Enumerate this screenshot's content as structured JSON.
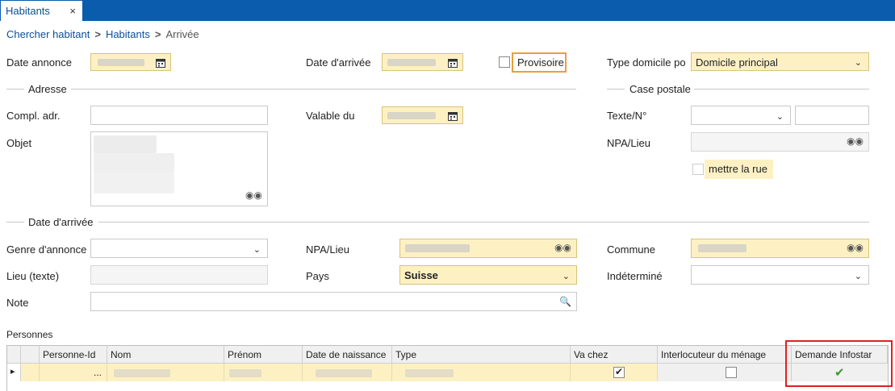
{
  "tab": {
    "label": "Habitants",
    "close": "×"
  },
  "breadcrumb": {
    "item1": "Chercher habitant",
    "item2": "Habitants",
    "current": "Arrivée",
    "sep": ">"
  },
  "top": {
    "date_annonce_label": "Date annonce",
    "date_arrivee_label": "Date d'arrivée",
    "provisoire_label": "Provisoire",
    "type_domicile_label": "Type domicile po",
    "type_domicile_value": "Domicile principal"
  },
  "adresse": {
    "section": "Adresse",
    "compl_label": "Compl. adr.",
    "valable_label": "Valable du",
    "objet_label": "Objet"
  },
  "case_postale": {
    "section": "Case postale",
    "texte_label": "Texte/N°",
    "npa_label": "NPA/Lieu",
    "mettre_rue": "mettre la rue"
  },
  "arrivee": {
    "section": "Date d'arrivée",
    "genre_label": "Genre d'annonce",
    "npa_label": "NPA/Lieu",
    "commune_label": "Commune",
    "lieu_label": "Lieu (texte)",
    "pays_label": "Pays",
    "pays_value": "Suisse",
    "indetermine_label": "Indéterminé",
    "note_label": "Note"
  },
  "personnes": {
    "section": "Personnes",
    "columns": [
      "Personne-Id",
      "Nom",
      "Prénom",
      "Date de naissance",
      "Type",
      "Va chez",
      "Interlocuteur du ménage",
      "Demande Infostar"
    ],
    "row_marker": "▸",
    "row_ellipsis": "...",
    "check": "✔"
  },
  "colors": {
    "accent": "#0b5cad",
    "yellow_field": "#fdf1c4",
    "highlight": "#e02020",
    "provisoire_border": "#e8a03a"
  }
}
